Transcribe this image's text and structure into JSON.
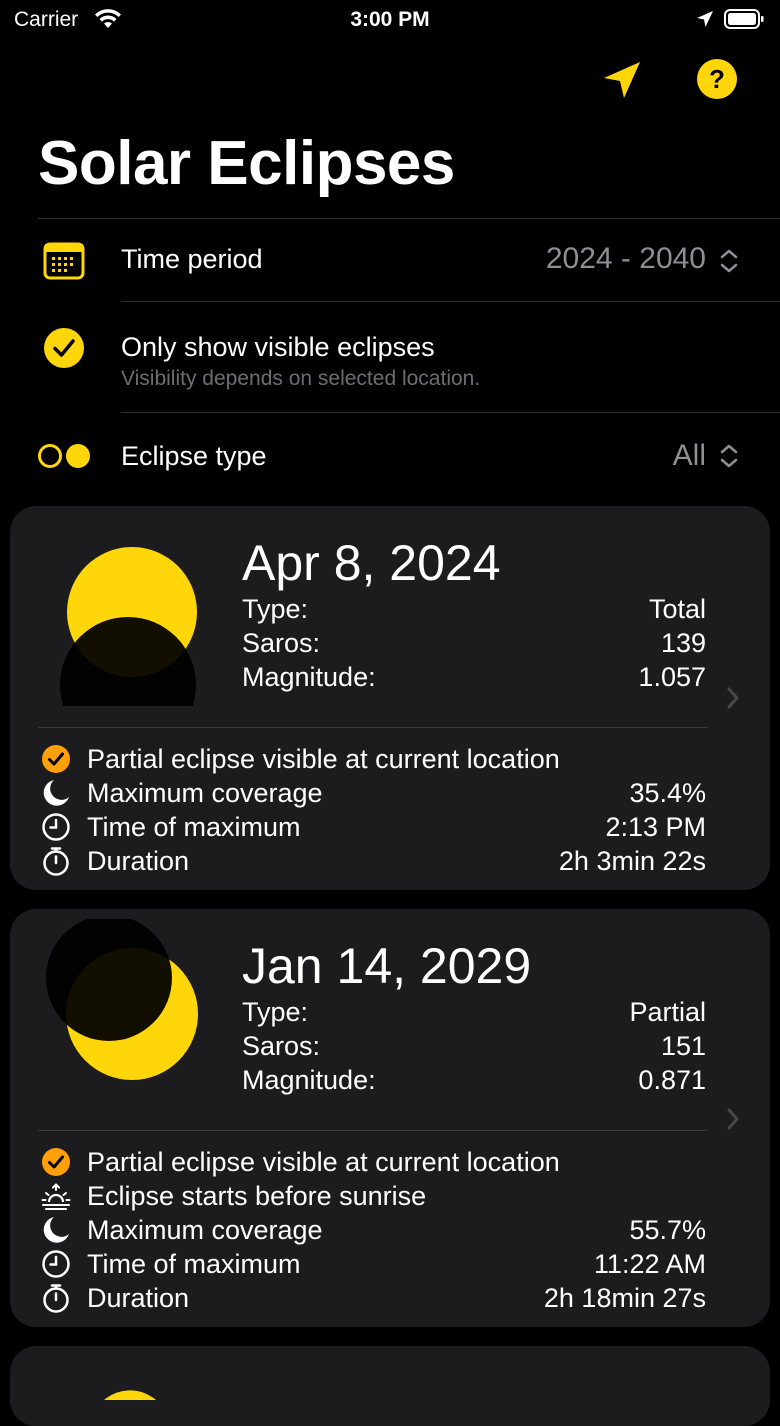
{
  "status_bar": {
    "carrier": "Carrier",
    "time": "3:00 PM"
  },
  "toolbar": {
    "location_icon": "location-arrow-icon",
    "help_icon": "help-icon",
    "help_label": "?"
  },
  "page_title": "Solar Eclipses",
  "filters": {
    "time_period": {
      "icon": "calendar-icon",
      "label": "Time period",
      "value": "2024 - 2040"
    },
    "visible_only": {
      "icon": "checkmark-circle-icon",
      "label": "Only show visible eclipses",
      "sub": "Visibility depends on selected location.",
      "checked": true
    },
    "eclipse_type": {
      "icon": "eclipse-type-icon",
      "label": "Eclipse type",
      "value": "All"
    }
  },
  "colors": {
    "accent": "#ffd60a",
    "orange": "#ff9f0a",
    "card_bg": "#1c1c1e",
    "secondary_text": "#8e8e93"
  },
  "labels": {
    "type": "Type:",
    "saros": "Saros:",
    "magnitude": "Magnitude:"
  },
  "eclipses": [
    {
      "date": "Apr 8, 2024",
      "type": "Total",
      "saros": "139",
      "magnitude": "1.057",
      "details": [
        {
          "icon": "checkmark-circle-icon",
          "label": "Partial eclipse visible at current location",
          "value": ""
        },
        {
          "icon": "moon-icon",
          "label": "Maximum coverage",
          "value": "35.4%"
        },
        {
          "icon": "clock-icon",
          "label": "Time of maximum",
          "value": "2:13 PM"
        },
        {
          "icon": "stopwatch-icon",
          "label": "Duration",
          "value": "2h 3min 22s"
        }
      ]
    },
    {
      "date": "Jan 14, 2029",
      "type": "Partial",
      "saros": "151",
      "magnitude": "0.871",
      "details": [
        {
          "icon": "checkmark-circle-icon",
          "label": "Partial eclipse visible at current location",
          "value": ""
        },
        {
          "icon": "sunrise-icon",
          "label": "Eclipse starts before sunrise",
          "value": ""
        },
        {
          "icon": "moon-icon",
          "label": "Maximum coverage",
          "value": "55.7%"
        },
        {
          "icon": "clock-icon",
          "label": "Time of maximum",
          "value": "11:22 AM"
        },
        {
          "icon": "stopwatch-icon",
          "label": "Duration",
          "value": "2h 18min 27s"
        }
      ]
    }
  ]
}
